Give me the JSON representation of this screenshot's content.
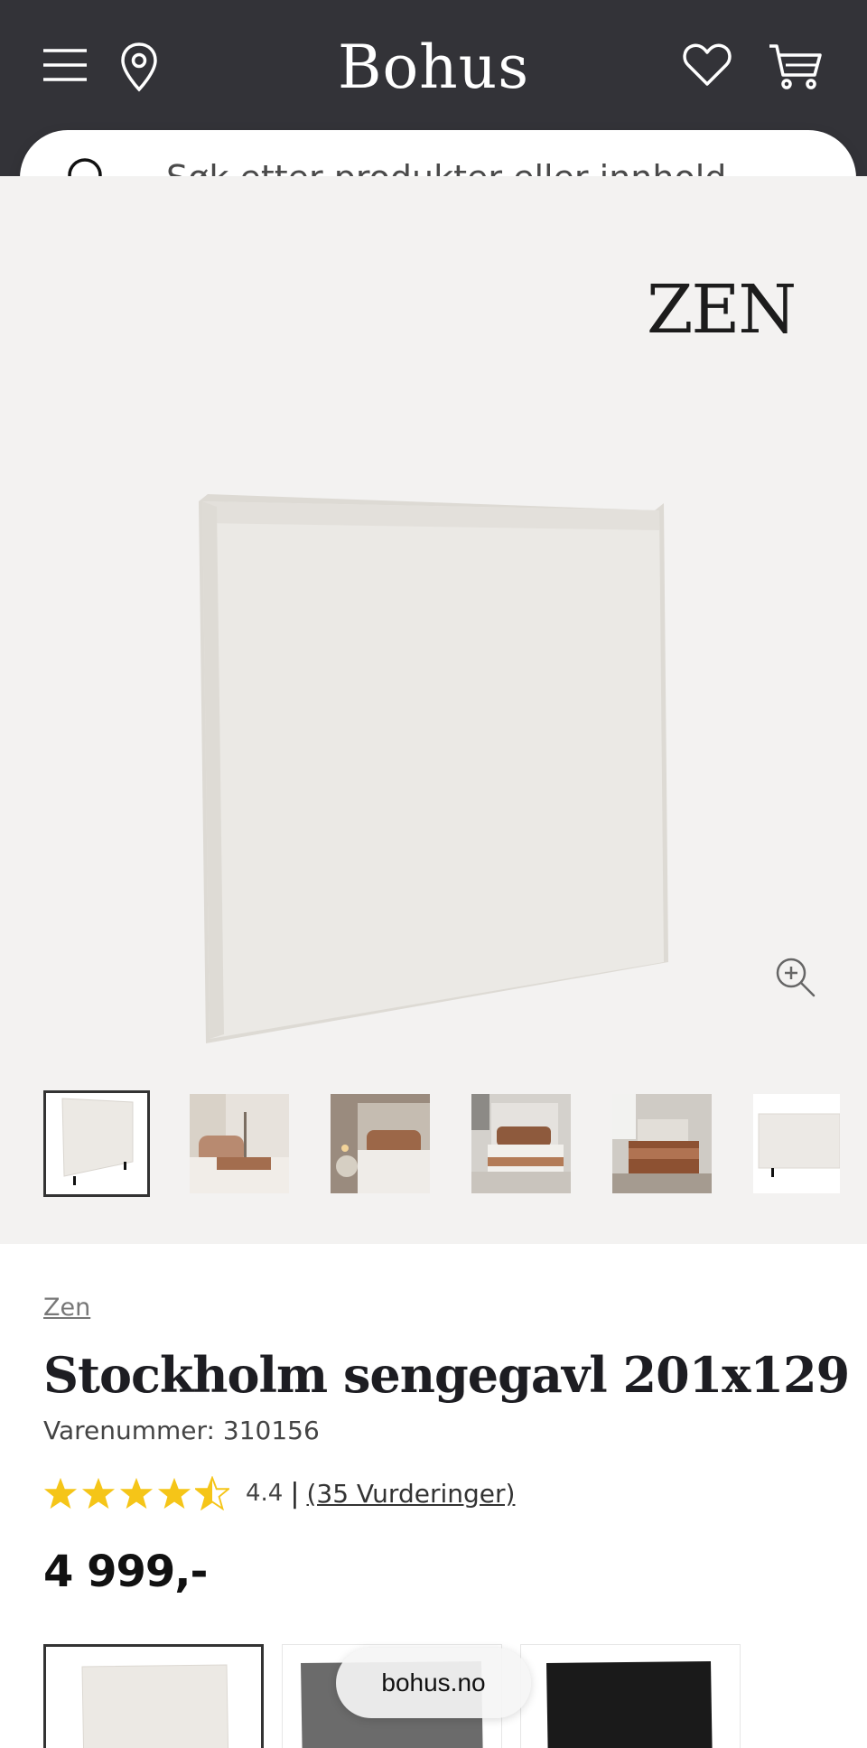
{
  "header": {
    "logo": "Bohus",
    "icons": {
      "menu": "menu-icon",
      "location": "location-pin-icon",
      "favorites": "heart-icon",
      "cart": "cart-icon"
    },
    "background": "#333338"
  },
  "search": {
    "placeholder": "Søk etter produkter eller innhold ..."
  },
  "gallery": {
    "brand_logo": "ZEN",
    "background": "#f3f2f1",
    "thumbnail_count": 6,
    "active_thumbnail": 1
  },
  "product": {
    "brand": "Zen",
    "title": "Stockholm sengegavl 201x129",
    "sku": "Varenummer: 310156",
    "rating_value": "4.4",
    "rating_separator": "|",
    "rating_count": "(35 Vurderinger)",
    "stars": 4.5,
    "price": "4 999,-",
    "star_color": "#f5c518"
  },
  "variants": {
    "selected": 1
  },
  "browser": {
    "url": "bohus.no"
  }
}
